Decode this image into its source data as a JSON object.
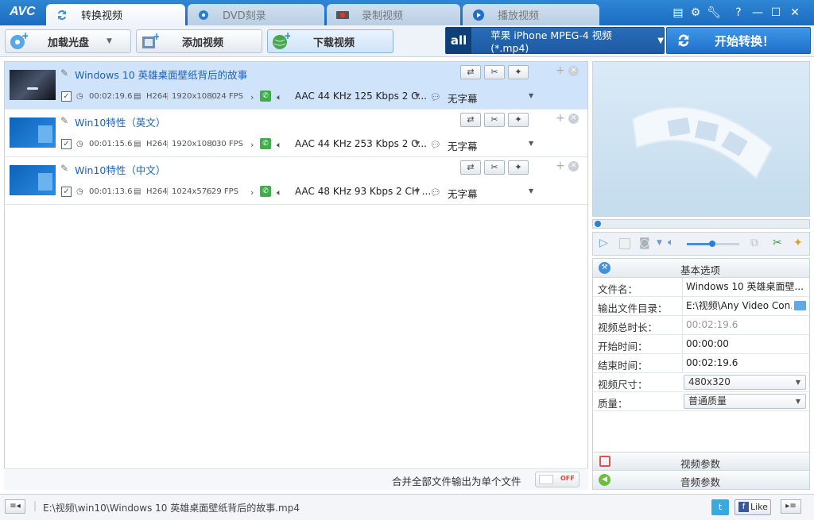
{
  "app": {
    "logo": "AVC"
  },
  "tabs": [
    {
      "label": "转换视频",
      "active": true
    },
    {
      "label": "DVD刻录",
      "active": false
    },
    {
      "label": "录制视频",
      "active": false
    },
    {
      "label": "播放视频",
      "active": false
    }
  ],
  "window_controls": {
    "settings": "⚙",
    "help": "?",
    "minimize": "—",
    "maximize": "☐",
    "close": "✕"
  },
  "toolbar": {
    "load_disc": "加载光盘",
    "add_video": "添加视频",
    "download_video": "下载视频",
    "profile_badge": "all",
    "profile": "苹果 iPhone MPEG-4 视频 (*.mp4)",
    "start": "开始转换！"
  },
  "files": [
    {
      "name": "Windows 10 英雄桌面壁纸背后的故事",
      "duration": "00:02:19.6",
      "codec": "H264",
      "resolution": "1920x1080",
      "fps": "24 FPS",
      "audio": "AAC 44 KHz 125 Kbps 2 C...",
      "subtitle": "无字幕",
      "selected": true
    },
    {
      "name": "Win10特性（英文）",
      "duration": "00:01:15.6",
      "codec": "H264",
      "resolution": "1920x1080",
      "fps": "30 FPS",
      "audio": "AAC 44 KHz 253 Kbps 2 C...",
      "subtitle": "无字幕",
      "selected": false
    },
    {
      "name": "Win10特性（中文）",
      "duration": "00:01:13.6",
      "codec": "H264",
      "resolution": "1024x576",
      "fps": "29 FPS",
      "audio": "AAC 48 KHz 93 Kbps 2 CH ...",
      "subtitle": "无字幕",
      "selected": false
    }
  ],
  "merge": {
    "label": "合并全部文件输出为单个文件",
    "toggle": "OFF"
  },
  "properties": {
    "basic_header": "基本选项",
    "rows": [
      {
        "label": "文件名：",
        "value": "Windows 10 英雄桌面壁..."
      },
      {
        "label": "输出文件目录：",
        "value": "E:\\视频\\Any Video Con..."
      },
      {
        "label": "视频总时长：",
        "value": "00:02:19.6"
      },
      {
        "label": "开始时间：",
        "value": "00:00:00"
      },
      {
        "label": "结束时间：",
        "value": "00:02:19.6"
      },
      {
        "label": "视频尺寸：",
        "value": "480x320"
      },
      {
        "label": "质量：",
        "value": "普通质量"
      }
    ],
    "video_params": "视频参数",
    "audio_params": "音频参数"
  },
  "status": {
    "path": "E:\\视频\\win10\\Windows 10 英雄桌面壁纸背后的故事.mp4",
    "like": "Like"
  },
  "colors": {
    "accent": "#1b6cc0",
    "selected_row": "#cfe3fb",
    "link": "#1a62b8"
  }
}
